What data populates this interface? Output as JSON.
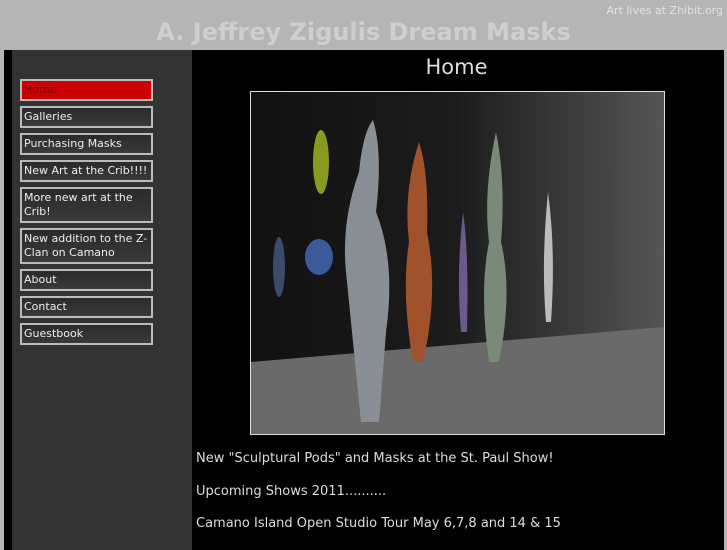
{
  "header": {
    "tagline": "Art lives at Zhibit.org",
    "title": "A. Jeffrey Zigulis Dream Masks"
  },
  "nav": {
    "items": [
      {
        "label": "Home",
        "active": true
      },
      {
        "label": "Galleries"
      },
      {
        "label": "Purchasing Masks"
      },
      {
        "label": "New Art at the Crib!!!!"
      },
      {
        "label": "More new art at the Crib!"
      },
      {
        "label": "New addition to the Z-Clan on Camano"
      },
      {
        "label": "About"
      },
      {
        "label": "Contact"
      },
      {
        "label": "Guestbook"
      }
    ]
  },
  "main": {
    "title": "Home",
    "paragraphs": [
      "New \"Sculptural Pods\" and Masks at the St. Paul Show!",
      "Upcoming Shows 2011..........",
      "Camano Island Open Studio Tour  May 6,7,8 and 14 & 15"
    ]
  }
}
